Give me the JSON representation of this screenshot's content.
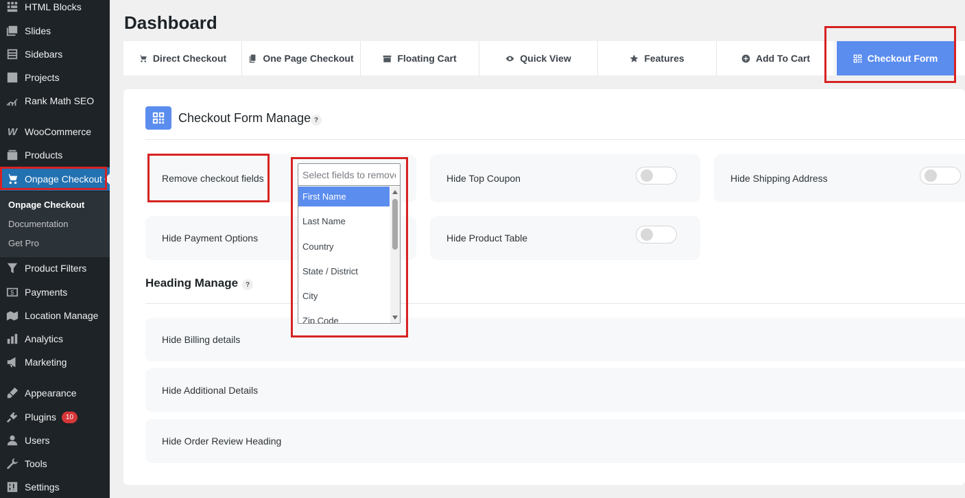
{
  "sidebar": {
    "items": [
      {
        "label": "HTML Blocks",
        "icon": "grid-icon"
      },
      {
        "label": "Slides",
        "icon": "slides-icon"
      },
      {
        "label": "Sidebars",
        "icon": "sidebars-icon"
      },
      {
        "label": "Projects",
        "icon": "projects-icon"
      },
      {
        "label": "Rank Math SEO",
        "icon": "chart-icon"
      },
      {
        "label": "WooCommerce",
        "icon": "woo-icon"
      },
      {
        "label": "Products",
        "icon": "products-icon"
      },
      {
        "label": "Onpage Checkout",
        "icon": "cart-icon"
      },
      {
        "label": "Product Filters",
        "icon": "filter-icon"
      },
      {
        "label": "Payments",
        "icon": "dollar-icon"
      },
      {
        "label": "Location Manage",
        "icon": "location-icon"
      },
      {
        "label": "Analytics",
        "icon": "bar-chart-icon"
      },
      {
        "label": "Marketing",
        "icon": "megaphone-icon"
      },
      {
        "label": "Appearance",
        "icon": "brush-icon"
      },
      {
        "label": "Plugins",
        "icon": "plug-icon",
        "badge": "10"
      },
      {
        "label": "Users",
        "icon": "user-icon"
      },
      {
        "label": "Tools",
        "icon": "wrench-icon"
      },
      {
        "label": "Settings",
        "icon": "settings-icon"
      }
    ],
    "submenu": [
      "Onpage Checkout",
      "Documentation",
      "Get Pro"
    ]
  },
  "page_title": "Dashboard",
  "tabs": [
    {
      "label": "Direct Checkout",
      "icon": "cart-icon"
    },
    {
      "label": "One Page Checkout",
      "icon": "copy-icon"
    },
    {
      "label": "Floating Cart",
      "icon": "archive-icon"
    },
    {
      "label": "Quick View",
      "icon": "eye-icon"
    },
    {
      "label": "Features",
      "icon": "star-icon"
    },
    {
      "label": "Add To Cart",
      "icon": "plus-circle-icon"
    },
    {
      "label": "Checkout Form",
      "icon": "qr-icon"
    }
  ],
  "checkout_section": {
    "title": "Checkout Form Manage",
    "help": "?",
    "remove_fields_label": "Remove checkout fields",
    "select_placeholder": "Select fields to remove",
    "options": [
      "First Name",
      "Last Name",
      "Country",
      "State / District",
      "City",
      "Zip Code"
    ],
    "hide_top_coupon": "Hide Top Coupon",
    "hide_shipping_address": "Hide Shipping Address",
    "hide_payment_options": "Hide Payment Options",
    "hide_product_table": "Hide Product Table"
  },
  "heading_section": {
    "title": "Heading Manage",
    "help": "?",
    "hide_billing": "Hide Billing details",
    "hide_additional": "Hide Additional Details",
    "hide_order_review": "Hide Order Review Heading"
  },
  "colors": {
    "accent": "#5b8def",
    "sidebar_bg": "#1d2327",
    "active_menu": "#2271b1",
    "highlight_box": "#d72222"
  }
}
